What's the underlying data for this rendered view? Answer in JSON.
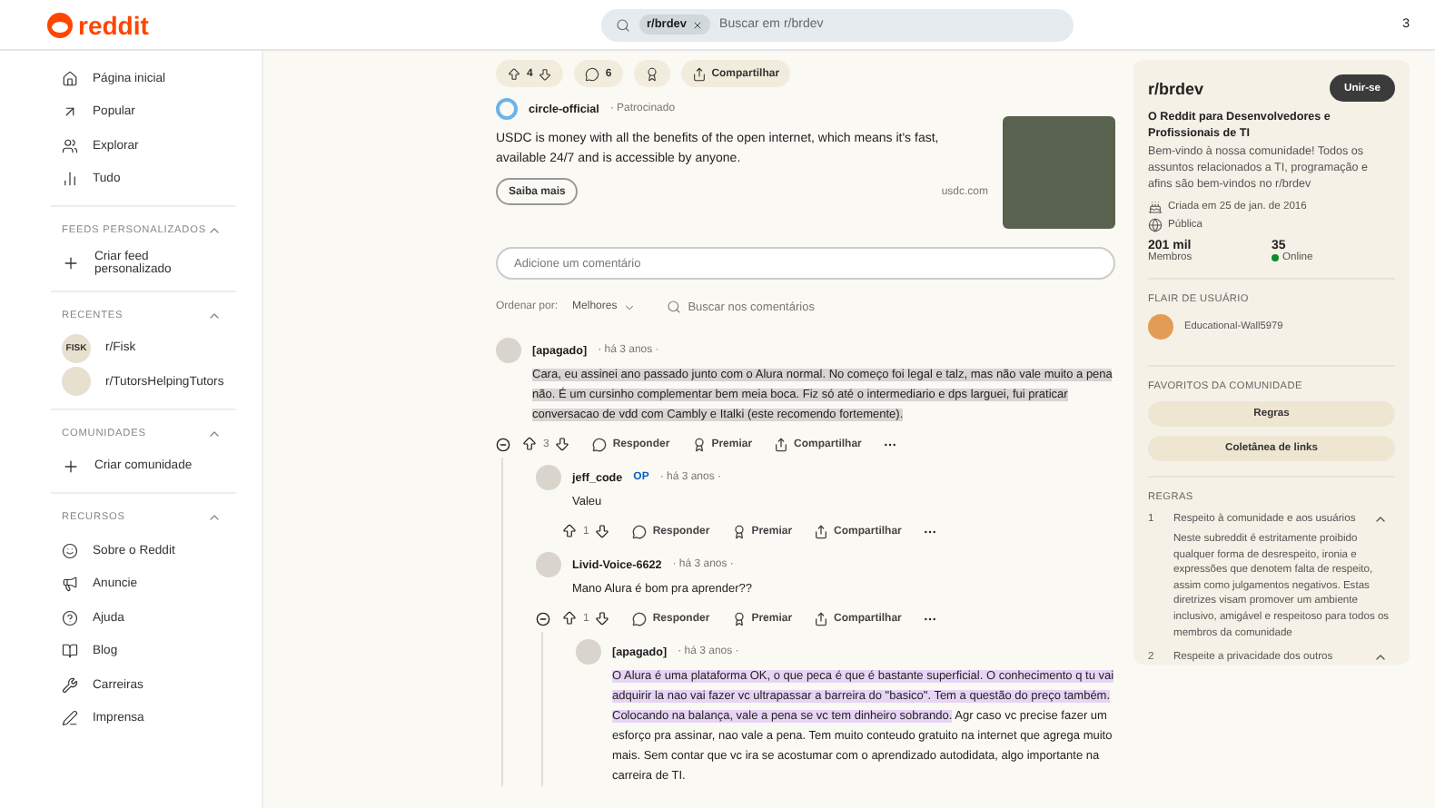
{
  "header": {
    "logo": "reddit",
    "search_chip": "r/brdev",
    "search_placeholder": "Buscar em r/brdev",
    "corner_text": "3"
  },
  "sidebar": {
    "nav": [
      {
        "label": "Página inicial",
        "selected": false
      },
      {
        "label": "Popular",
        "selected": false
      },
      {
        "label": "Explorar",
        "selected": false
      },
      {
        "label": "Tudo",
        "selected": false
      }
    ],
    "sections": [
      {
        "title": "FEEDS PERSONALIZADOS",
        "expanded": true,
        "items": [
          {
            "kind": "action",
            "label": "Criar feed personalizado"
          }
        ]
      },
      {
        "title": "RECENTES",
        "expanded": true,
        "items": [
          {
            "kind": "community",
            "label": "r/Fisk",
            "avatar_text": "FISK"
          },
          {
            "kind": "community",
            "label": "r/TutorsHelpingTutors"
          }
        ]
      },
      {
        "title": "COMUNIDADES",
        "expanded": true,
        "items": [
          {
            "kind": "action",
            "label": "Criar comunidade"
          }
        ]
      },
      {
        "title": "RECURSOS",
        "expanded": true,
        "items": [
          {
            "kind": "resource",
            "label": "Sobre o Reddit"
          },
          {
            "kind": "resource",
            "label": "Anuncie"
          },
          {
            "kind": "resource",
            "label": "Ajuda"
          },
          {
            "kind": "resource",
            "label": "Blog"
          },
          {
            "kind": "resource",
            "label": "Carreiras"
          },
          {
            "kind": "resource",
            "label": "Imprensa"
          }
        ]
      }
    ]
  },
  "post_actions": {
    "votes": "4",
    "comments": "6",
    "share": "Compartilhar"
  },
  "ad": {
    "author": "circle-official",
    "tag": "· Patrocinado",
    "text": "USDC is money with all the benefits of the open internet, which means it's fast, available 24/7 and is accessible by anyone.",
    "button": "Saiba mais",
    "domain": "usdc.com"
  },
  "comment_box": {
    "placeholder": "Adicione um comentário"
  },
  "sort": {
    "label": "Ordenar por:",
    "value": "Melhores",
    "search_placeholder": "Buscar nos comentários"
  },
  "comments": [
    {
      "author": "[apagado]",
      "op": false,
      "time": "· há 3 anos ·",
      "highlighted_text": "Cara, eu assinei ano passado junto com o Alura normal. No começo foi legal e talz, mas não vale muito a pena não. É um cursinho complementar bem meia boca. Fiz só até o intermediario e dps larguei, fui praticar conversacao de vdd com Cambly e Italki (este recomendo fortemente).",
      "color": "#d7d5d2",
      "votes": "3",
      "expanded": true,
      "actions": [
        "Responder",
        "Premiar",
        "Compartilhar"
      ],
      "children": [
        {
          "author": "jeff_code",
          "op": true,
          "op_label": "OP",
          "time": "· há 3 anos ·",
          "text": "Valeu",
          "votes": "1",
          "expanded": false,
          "actions": [
            "Responder",
            "Premiar",
            "Compartilhar"
          ]
        },
        {
          "author": "Livid-Voice-6622",
          "op": false,
          "time": "· há 3 anos ·",
          "text": "Mano Alura é bom pra aprender??",
          "votes": "1",
          "expanded": true,
          "actions": [
            "Responder",
            "Premiar",
            "Compartilhar"
          ],
          "children": [
            {
              "author": "[apagado]",
              "op": false,
              "time": "· há 3 anos ·",
              "highlighted_text": "O Alura é uma plataforma OK, o que peca é que é bastante superficial. O conhecimento q tu vai adquirir la nao vai fazer vc ultrapassar a barreira do \"basico\". Tem a questão do preço também. Colocando na balança, vale a pena se vc tem dinheiro sobrando.",
              "color": "#e7d4f5",
              "text": " Agr caso vc precise fazer um esforço pra assinar, nao vale a pena. Tem muito conteudo gratuito na internet que agrega muito mais. Sem contar que vc ira se acostumar com o aprendizado autodidata, algo importante na carreira de TI."
            }
          ]
        }
      ]
    }
  ],
  "community": {
    "name": "r/brdev",
    "join": "Unir-se",
    "headline": "O Reddit para Desenvolvedores e Profissionais de TI",
    "description": "Bem-vindo à nossa comunidade! Todos os assuntos relacionados a TI, programação e afins são bem-vindos no r/brdev",
    "created": "Criada em 25 de jan. de 2016",
    "visibility": "Pública",
    "members": "201 mil",
    "members_label": "Membros",
    "online": "35",
    "online_label": "Online",
    "flair_title": "FLAIR DE USUÁRIO",
    "flair_user": "Educational-Wall5979",
    "favorites_title": "FAVORITOS DA COMUNIDADE",
    "favorites": [
      "Regras",
      "Coletânea de links"
    ],
    "rules_title": "REGRAS",
    "rules": [
      {
        "number": "1",
        "title": "Respeito à comunidade e aos usuários",
        "expanded": true,
        "body": "Neste subreddit é estritamente proibido qualquer forma de desrespeito, ironia e expressões que denotem falta de respeito, assim como julgamentos negativos. Estas diretrizes visam promover um ambiente inclusivo, amigável e respeitoso para todos os membros da comunidade"
      },
      {
        "number": "2",
        "title": "Respeite a privacidade dos outros",
        "expanded": true
      }
    ]
  }
}
